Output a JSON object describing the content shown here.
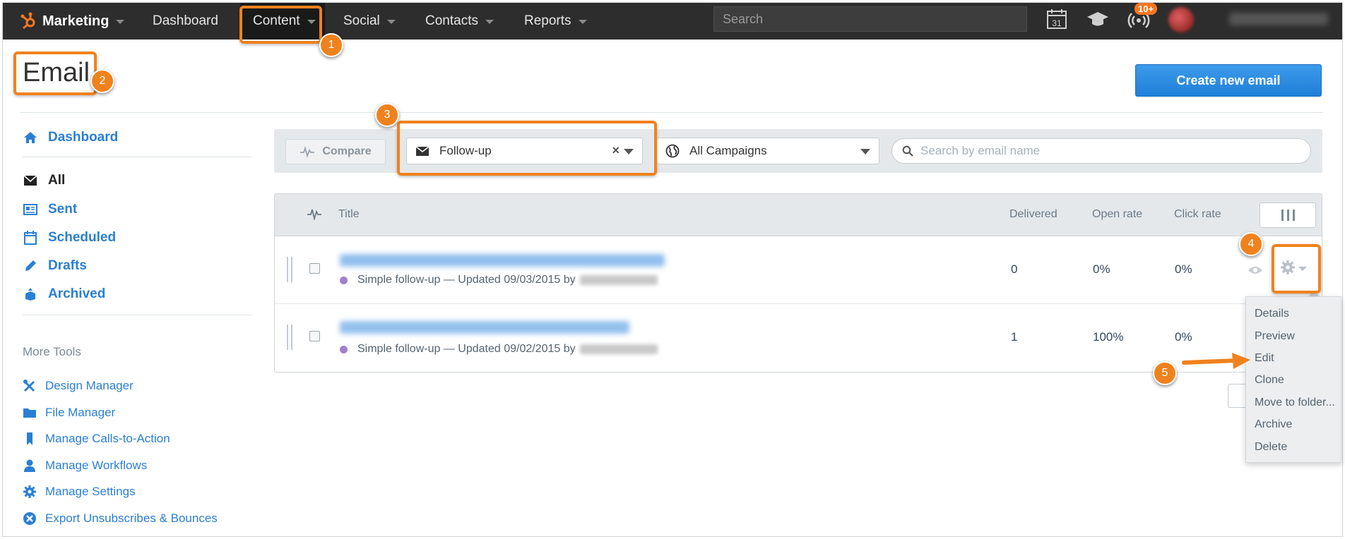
{
  "topnav": {
    "brand": "Marketing",
    "items": [
      {
        "label": "Dashboard"
      },
      {
        "label": "Content"
      },
      {
        "label": "Social"
      },
      {
        "label": "Contacts"
      },
      {
        "label": "Reports"
      }
    ],
    "search_placeholder": "Search",
    "calendar_day": "31",
    "notification_badge": "10+"
  },
  "page": {
    "title": "Email",
    "create_button": "Create new email"
  },
  "sidebar": {
    "dashboard": "Dashboard",
    "items": [
      {
        "label": "All"
      },
      {
        "label": "Sent"
      },
      {
        "label": "Scheduled"
      },
      {
        "label": "Drafts"
      },
      {
        "label": "Archived"
      }
    ],
    "more_tools_heading": "More Tools",
    "tools": [
      {
        "label": "Design Manager"
      },
      {
        "label": "File Manager"
      },
      {
        "label": "Manage Calls-to-Action"
      },
      {
        "label": "Manage Workflows"
      },
      {
        "label": "Manage Settings"
      },
      {
        "label": "Export Unsubscribes & Bounces"
      }
    ]
  },
  "filters": {
    "compare": "Compare",
    "type_filter": "Follow-up",
    "type_clear": "×",
    "campaign_filter": "All Campaigns",
    "search_placeholder": "Search by email name"
  },
  "table": {
    "headers": {
      "title": "Title",
      "delivered": "Delivered",
      "open_rate": "Open rate",
      "click_rate": "Click rate"
    },
    "rows": [
      {
        "meta": "Simple follow-up — Updated 09/03/2015 by",
        "delivered": "0",
        "open_rate": "0%",
        "click_rate": "0%"
      },
      {
        "meta": "Simple follow-up — Updated 09/02/2015 by",
        "delivered": "1",
        "open_rate": "100%",
        "click_rate": "0%"
      }
    ]
  },
  "row_menu": {
    "items": [
      "Details",
      "Preview",
      "Edit",
      "Clone",
      "Move to folder...",
      "Archive",
      "Delete"
    ]
  },
  "callouts": [
    "1",
    "2",
    "3",
    "4",
    "5"
  ],
  "colors": {
    "accent": "#f0821e",
    "link": "#2a7fd4",
    "primary_button": "#1f7fd8",
    "nav_bg": "#2d2d2d"
  }
}
